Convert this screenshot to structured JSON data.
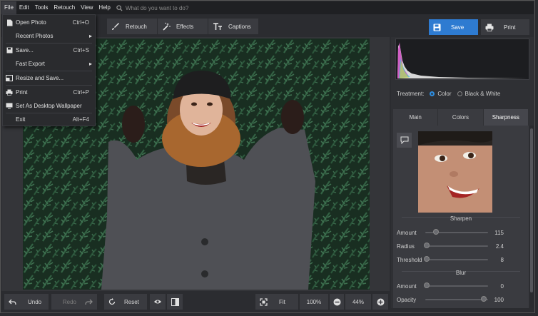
{
  "menubar": {
    "items": [
      "File",
      "Edit",
      "Tools",
      "Retouch",
      "View",
      "Help"
    ],
    "search_placeholder": "What do you want to do?"
  },
  "toolbar": {
    "tabs": [
      {
        "label": "Retouch",
        "icon": "brush-icon"
      },
      {
        "label": "Effects",
        "icon": "magic-wand-icon"
      },
      {
        "label": "Captions",
        "icon": "text-icon"
      }
    ],
    "save_label": "Save",
    "print_label": "Print",
    "accent_color": "#2e7bd1"
  },
  "file_menu": {
    "items": [
      {
        "label": "Open Photo",
        "shortcut": "Ctrl+O",
        "icon": "open-file-icon"
      },
      {
        "label": "Recent Photos",
        "shortcut": "",
        "submenu": true
      },
      {
        "label": "Save...",
        "shortcut": "Ctrl+S",
        "icon": "save-icon"
      },
      {
        "label": "Fast Export",
        "shortcut": "",
        "submenu": true
      },
      {
        "label": "Resize and Save...",
        "shortcut": "",
        "icon": "resize-icon"
      },
      {
        "label": "Print",
        "shortcut": "Ctrl+P",
        "icon": "print-icon"
      },
      {
        "label": "Set As Desktop Wallpaper",
        "shortcut": "",
        "icon": "monitor-icon"
      },
      {
        "label": "Exit",
        "shortcut": "Alt+F4"
      }
    ]
  },
  "treatment": {
    "label": "Treatment:",
    "options": [
      {
        "label": "Color",
        "selected": true
      },
      {
        "label": "Black & White",
        "selected": false
      }
    ]
  },
  "panel_tabs": [
    {
      "label": "Main",
      "active": false
    },
    {
      "label": "Colors",
      "active": false
    },
    {
      "label": "Sharpness",
      "active": true
    }
  ],
  "sharpen": {
    "title": "Sharpen",
    "sliders": [
      {
        "label": "Amount",
        "value": "115",
        "fraction": 0.12
      },
      {
        "label": "Radius",
        "value": "2.4",
        "fraction": 0.0
      },
      {
        "label": "Threshold",
        "value": "8",
        "fraction": 0.0
      }
    ]
  },
  "blur": {
    "title": "Blur",
    "sliders": [
      {
        "label": "Amount",
        "value": "0",
        "fraction": 0.0
      },
      {
        "label": "Opacity",
        "value": "100",
        "fraction": 0.92
      }
    ]
  },
  "bottombar": {
    "undo_label": "Undo",
    "redo_label": "Redo",
    "reset_label": "Reset",
    "fit_label": "Fit",
    "zoom_100": "100%",
    "zoom_current": "44%"
  }
}
